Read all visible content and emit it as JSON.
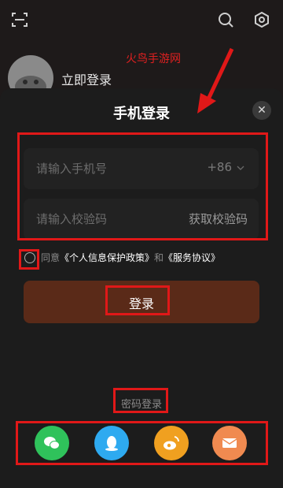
{
  "header": {
    "login_now": "立即登录",
    "watermark": "火鸟手游网"
  },
  "sheet": {
    "title": "手机登录",
    "close_glyph": "✕"
  },
  "phone_field": {
    "placeholder": "请输入手机号",
    "country_code": "+86"
  },
  "code_field": {
    "placeholder": "请输入校验码",
    "get_code": "获取校验码"
  },
  "agreement": {
    "prefix": "同意",
    "privacy": "《个人信息保护政策》",
    "and": "和",
    "service": "《服务协议》"
  },
  "login_button": {
    "label": "登录"
  },
  "password_login": {
    "label": "密码登录"
  },
  "social": [
    "wechat-icon",
    "qq-icon",
    "weibo-icon",
    "email-icon"
  ],
  "colors": {
    "annotation_red": "#e01818",
    "login_button_bg": "#5a2a18",
    "wechat": "#2fc25b",
    "qq": "#2eaaf0",
    "weibo": "#f0a020",
    "email": "#f08a50"
  }
}
